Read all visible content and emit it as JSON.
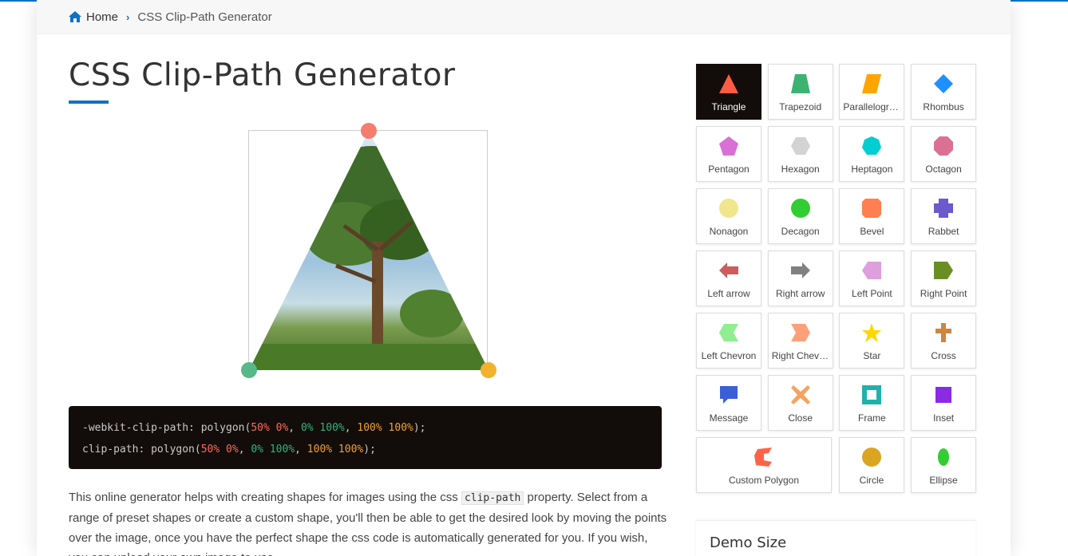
{
  "breadcrumb": {
    "home": "Home",
    "current": "CSS Clip-Path Generator"
  },
  "page_title": "CSS Clip-Path Generator",
  "code": {
    "line1_prop": "-webkit-clip-path: polygon(",
    "line2_prop": "clip-path: polygon(",
    "p1": "50% 0%",
    "p2": "0% 100%",
    "p3": "100% 100%",
    "sep": ", ",
    "end": ");"
  },
  "description": {
    "before": "This online generator helps with creating shapes for images using the css ",
    "code": "clip-path",
    "after": " property. Select from a range of preset shapes or create a custom shape, you'll then be able to get the desired look by moving the points over the image, once you have the perfect shape the css code is automatically generated for you. If you wish, you can upload your own image to use."
  },
  "shapes": [
    {
      "label": "Triangle",
      "color": "#ff5a44"
    },
    {
      "label": "Trapezoid",
      "color": "#3cb371"
    },
    {
      "label": "Parallelogram",
      "color": "#ffa500"
    },
    {
      "label": "Rhombus",
      "color": "#1e90ff"
    },
    {
      "label": "Pentagon",
      "color": "#da70d6"
    },
    {
      "label": "Hexagon",
      "color": "#d3d3d3"
    },
    {
      "label": "Heptagon",
      "color": "#00ced1"
    },
    {
      "label": "Octagon",
      "color": "#db7093"
    },
    {
      "label": "Nonagon",
      "color": "#f0e68c"
    },
    {
      "label": "Decagon",
      "color": "#32cd32"
    },
    {
      "label": "Bevel",
      "color": "#ff7f50"
    },
    {
      "label": "Rabbet",
      "color": "#6a5acd"
    },
    {
      "label": "Left arrow",
      "color": "#cd5c5c"
    },
    {
      "label": "Right arrow",
      "color": "#808080"
    },
    {
      "label": "Left Point",
      "color": "#dda0dd"
    },
    {
      "label": "Right Point",
      "color": "#6b8e23"
    },
    {
      "label": "Left Chevron",
      "color": "#90ee90"
    },
    {
      "label": "Right Chevron",
      "color": "#ffa07a"
    },
    {
      "label": "Star",
      "color": "#ffd700"
    },
    {
      "label": "Cross",
      "color": "#cd853f"
    },
    {
      "label": "Message",
      "color": "#3a5fd9"
    },
    {
      "label": "Close",
      "color": "#f4a460"
    },
    {
      "label": "Frame",
      "color": "#20b2aa"
    },
    {
      "label": "Inset",
      "color": "#8a2be2"
    },
    {
      "label": "Custom Polygon",
      "color": "#ff6347"
    },
    {
      "label": "Circle",
      "color": "#daa520"
    },
    {
      "label": "Ellipse",
      "color": "#32cd32"
    }
  ],
  "active_shape": "Triangle",
  "demo_size": {
    "heading": "Demo Size"
  },
  "colors": {
    "accent": "#0a72c7",
    "code_bg": "#120d0b",
    "handle_top": "#f47d6b",
    "handle_left": "#57b88a",
    "handle_right": "#f3b12d"
  }
}
